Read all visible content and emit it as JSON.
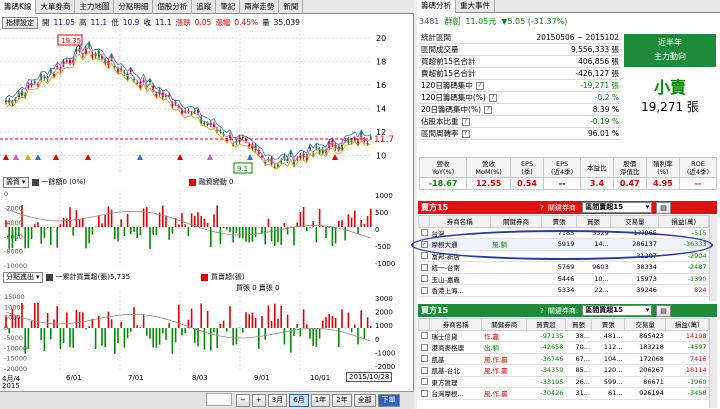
{
  "tabs": [
    "籌碼K線",
    "大單券商",
    "主力地圖",
    "分點明細",
    "個股分析",
    "追蹤",
    "筆記",
    "兩岸走勢",
    "新聞"
  ],
  "info": {
    "settings_btn": "指標設定",
    "open_label": "開",
    "open": "11.05",
    "high_label": "高",
    "high": "11.1",
    "low_label": "低",
    "low": "10.9",
    "close_label": "收",
    "close": "11.1",
    "change_label": "漲跌",
    "change": "0.05",
    "pct_label": "漲幅",
    "pct": "0.45%",
    "vol_label": "量",
    "volume": "35,039"
  },
  "price_chart": {
    "y_ticks": [
      "20",
      "18",
      "16",
      "14",
      "12",
      "10"
    ],
    "current_price": "11.7",
    "high_marker": "19.35",
    "low_marker": "9.1"
  },
  "chip_panel": {
    "select": "籌資",
    "legend1": "一餘額0 (0%)",
    "legend2": "融資變動 0",
    "y_ticks": [
      "0",
      "-2000",
      "-4000",
      "-6000",
      "-8000",
      "-10000"
    ],
    "right_ticks": [
      "1000",
      "500",
      "0",
      "-500",
      "-1000"
    ]
  },
  "branch_panel": {
    "select": "分點進出",
    "legend1": "一累計買賣超(張)5,735",
    "legend2": "買賣超(張)",
    "legend3": "買張 0 賣張 0",
    "y_ticks": [
      "15000",
      "10000",
      "5000",
      "0",
      "-5000",
      "-10000",
      "-15000",
      "-20000"
    ],
    "right_ticks": [
      "3000",
      "2000",
      "1000",
      "0",
      "-1000",
      "-2000"
    ]
  },
  "x_axis": {
    "labels": [
      "4月/4",
      "6/01",
      "7/01",
      "8/03",
      "9/01",
      "10/01"
    ],
    "year": "2015",
    "tooltip": "2015/10/28"
  },
  "bottom": {
    "zoom_out": "−",
    "zoom_in": "+",
    "ranges": [
      "3月",
      "6月",
      "1年",
      "2年",
      "全部"
    ],
    "selected": "6月",
    "trade_btn": "下單"
  },
  "right": {
    "tabs": [
      "籌碼分析",
      "重大事件"
    ],
    "stock_code": "3481",
    "stock_name": "群創",
    "price": "11.05元",
    "change": "▼5.05 (-31.37%)",
    "stats": [
      {
        "label": "統計區間",
        "value": "20150506 ~ 2015102"
      },
      {
        "label": "區間成交量",
        "value": "9,556,333 張"
      },
      {
        "label": "買超前15名合計",
        "value": "406,856 張"
      },
      {
        "label": "賣超前15名合計",
        "value": "-426,127 張"
      },
      {
        "label": "120日籌碼集中",
        "value": "-19,271 張"
      },
      {
        "label": "120日籌碼集中(%)",
        "value": "-0.2 %"
      },
      {
        "label": "20日籌碼集中(%)",
        "value": "8.39 %"
      },
      {
        "label": "佔股本比重",
        "value": "-0.19 %"
      },
      {
        "label": "區間周轉率",
        "value": "96.01 %"
      }
    ],
    "main_force": {
      "title": "近半年",
      "subtitle": "主力動向",
      "status": "小賣",
      "amount": "19,271 張"
    },
    "fin_headers": [
      "營收\nYoY(%)",
      "營收\nMoM(%)",
      "EPS\n(季)",
      "EPS\n(近4季)",
      "本益比",
      "股價\n淨值比",
      "殖利率\n(%)",
      "ROE\n(近4季)"
    ],
    "fin_values": [
      "-18.67",
      "12.55",
      "0.54",
      "--",
      "3.4",
      "0.47",
      "4.95",
      "--"
    ],
    "sell_section": {
      "title": "賣方15",
      "related": "關鍵券商:",
      "select": "區間賣超15",
      "headers": [
        "券商名稱",
        "關鍵券商",
        "賣張",
        "買張",
        "交易量",
        "損益(萬)"
      ],
      "rows": [
        {
          "name": "台灣...",
          "key": "",
          "sell": "7185",
          "buy": "5329",
          "vol": "1??965",
          "pnl": "-515"
        },
        {
          "name": "摩根大通",
          "key": "風.躺",
          "sell": "5919",
          "buy": "14...",
          "vol": "286137",
          "pnl": "-36333",
          "checked": true,
          "highlight": true
        },
        {
          "name": "富邦-新店",
          "key": "",
          "sell": "",
          "buy": "",
          "vol": "31207",
          "pnl": "-2904"
        },
        {
          "name": "統一-台南",
          "key": "",
          "sell": "5769",
          "buy": "9603",
          "vol": "38334",
          "pnl": "-2487"
        },
        {
          "name": "玉山-嘉義",
          "key": "",
          "sell": "5446",
          "buy": "10...",
          "vol": "15973",
          "pnl": "-1390"
        },
        {
          "name": "香港上海...",
          "key": "",
          "sell": "5334",
          "buy": "22...",
          "vol": "39246",
          "pnl": "824"
        }
      ]
    },
    "buy_section": {
      "title": "買方15",
      "related": "關鍵券商:",
      "select": "區間買超15",
      "headers": [
        "券商名稱",
        "關鍵券商",
        "買賣超",
        "買張",
        "賣張",
        "交易量",
        "損益(萬)"
      ],
      "rows": [
        {
          "name": "瑞士信貸",
          "key": "作.贏",
          "net": "-97135",
          "buy": "38...",
          "sell": "481...",
          "vol": "865423",
          "pnl": "14198"
        },
        {
          "name": "港商麥格理",
          "key": "出.躺",
          "net": "-42658",
          "buy": "70...",
          "sell": "112...",
          "vol": "183218",
          "pnl": "-4597"
        },
        {
          "name": "凱基",
          "key": "風.作.贏",
          "net": "-36746",
          "buy": "67...",
          "sell": "104...",
          "vol": "172068",
          "pnl": "7416"
        },
        {
          "name": "凱基-台北",
          "key": "風.作.贏",
          "net": "-34359",
          "buy": "85...",
          "sell": "120...",
          "vol": "206267",
          "pnl": "18114"
        },
        {
          "name": "東方匯理",
          "key": "",
          "net": "-33195",
          "buy": "26...",
          "sell": "599...",
          "vol": "86671",
          "pnl": "-1960"
        },
        {
          "name": "台灣摩根...",
          "key": "風.作.贏",
          "net": "-30426",
          "buy": "31...",
          "sell": "61...",
          "vol": "926194",
          "pnl": "-3458"
        }
      ]
    }
  }
}
